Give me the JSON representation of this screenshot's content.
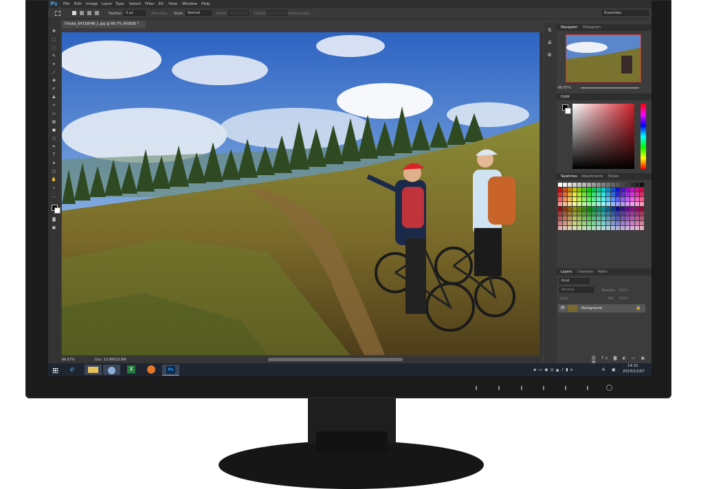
{
  "app": {
    "logo": "Ps",
    "menu": [
      "File",
      "Edit",
      "Image",
      "Layer",
      "Type",
      "Select",
      "Filter",
      "3D",
      "View",
      "Window",
      "Help"
    ],
    "options": {
      "feather_label": "Feather:",
      "feather_value": "0 px",
      "anti_alias_label": "Anti-alias",
      "style_label": "Style:",
      "style_value": "Normal",
      "width_label": "Width:",
      "height_label": "Height:",
      "refine_edge_label": "Refine Edge...",
      "workspace": "Essentials"
    },
    "document": {
      "tab_title": "Fotolia_64318048_L.jpg @ 66.7% (RGB/8) *",
      "status_zoom": "66.67%",
      "status_doc": "Doc: 10.6M/10.6M"
    },
    "panels": {
      "navigator_tabs": [
        "Navigator",
        "Histogram"
      ],
      "navigator_zoom": "66.67%",
      "color_tab": "Color",
      "swatch_tabs": [
        "Swatches",
        "Adjustments",
        "Styles"
      ],
      "layers_tabs": [
        "Layers",
        "Channels",
        "Paths"
      ],
      "layers_kind": "Kind",
      "blend_mode": "Normal",
      "opacity_label": "Opacity:",
      "opacity_value": "100%",
      "lock_label": "Lock:",
      "fill_label": "Fill:",
      "fill_value": "100%",
      "layer_name": "Background"
    },
    "taskbar": {
      "apps": [
        "start-icon",
        "ie-icon",
        "explorer-icon",
        "browser-icon",
        "excel-icon",
        "firefox-icon",
        "photoshop-icon"
      ],
      "ps_label": "Ps",
      "time": "14:31",
      "date": "2015/12/07",
      "ime": "A"
    }
  },
  "colors": {
    "ps_blue": "#36a1f2",
    "panel_bg": "#3c3c3c",
    "taskbar": "#1e2430",
    "bezel": "#1b1b1b"
  }
}
